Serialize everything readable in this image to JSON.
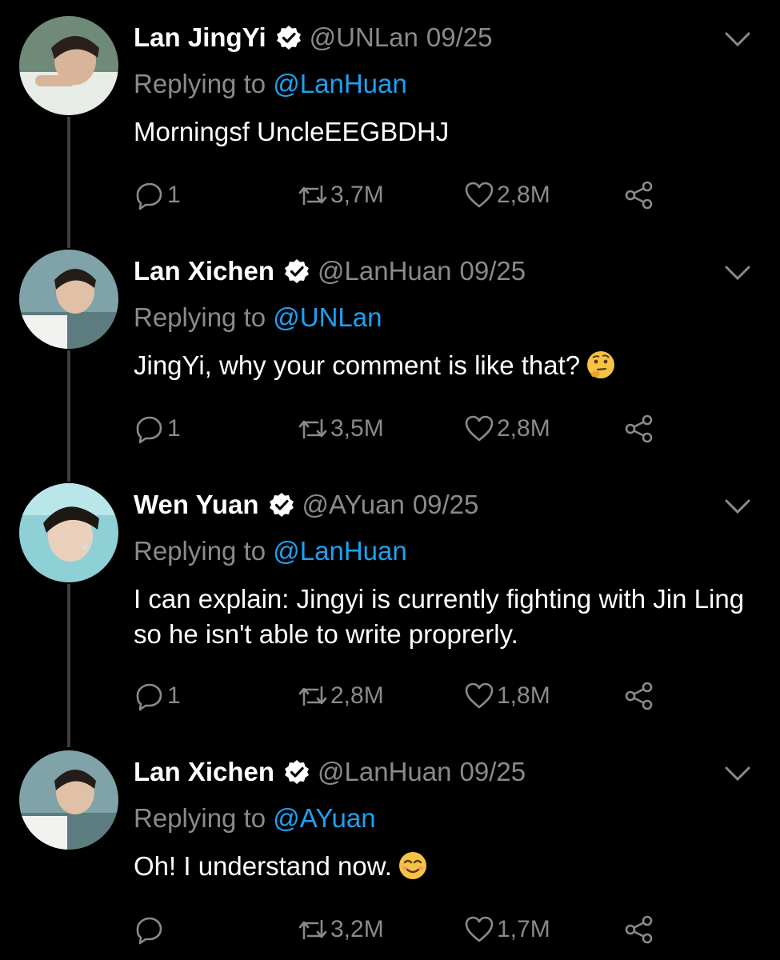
{
  "tweets": [
    {
      "name": "Lan JingYi",
      "handle": "@UNLan",
      "date": "09/25",
      "replying_prefix": "Replying to ",
      "replying_to": "@LanHuan",
      "text": "Morningsf UncleEEGBDHJ",
      "emoji": "",
      "replies": "1",
      "retweets": "3,7M",
      "likes": "2,8M"
    },
    {
      "name": "Lan Xichen",
      "handle": "@LanHuan",
      "date": "09/25",
      "replying_prefix": "Replying to ",
      "replying_to": "@UNLan",
      "text": "JingYi, why your comment is like that?",
      "emoji": "thinking-face",
      "replies": "1",
      "retweets": "3,5M",
      "likes": "2,8M"
    },
    {
      "name": "Wen Yuan",
      "handle": "@AYuan",
      "date": "09/25",
      "replying_prefix": "Replying to ",
      "replying_to": "@LanHuan",
      "text": "I can explain: Jingyi is currently fighting with Jin Ling so he isn't able to write proprerly.",
      "emoji": "",
      "replies": "1",
      "retweets": "2,8M",
      "likes": "1,8M"
    },
    {
      "name": "Lan Xichen",
      "handle": "@LanHuan",
      "date": "09/25",
      "replying_prefix": "Replying to ",
      "replying_to": "@AYuan",
      "text": "Oh! I understand now.",
      "emoji": "smiling-face",
      "replies": "",
      "retweets": "3,2M",
      "likes": "1,7M"
    }
  ],
  "colors": {
    "background": "#000000",
    "text": "#ffffff",
    "muted": "#8a8a8a",
    "link": "#1da1f2",
    "thread_line": "#3d3d3d"
  },
  "icons": [
    "verified-badge-icon",
    "chevron-down-icon",
    "reply-icon",
    "retweet-icon",
    "heart-icon",
    "share-icon"
  ]
}
